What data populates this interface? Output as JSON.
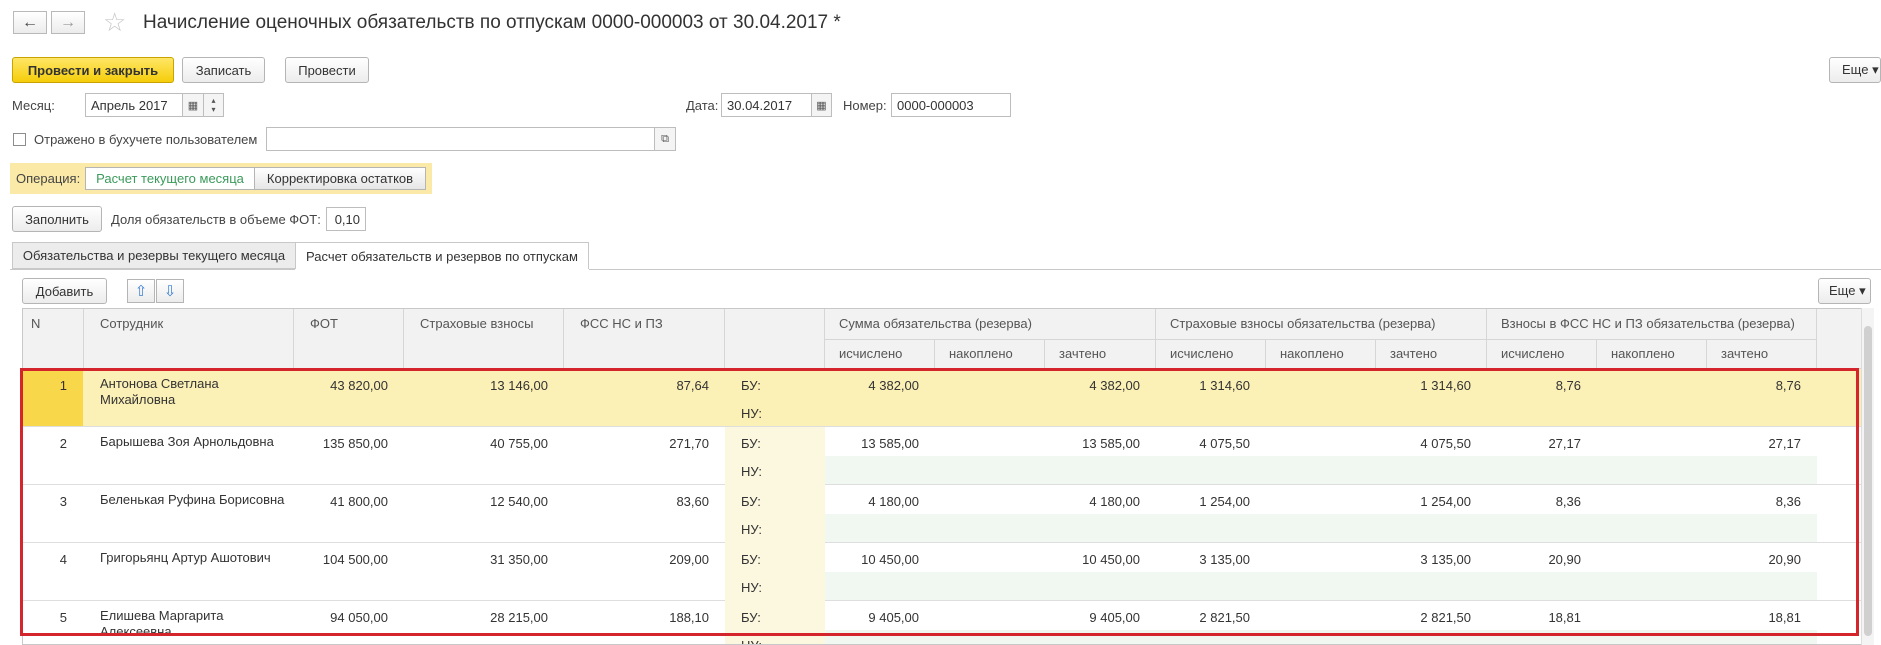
{
  "window": {
    "title": "Начисление оценочных обязательств по отпускам 0000-000003 от 30.04.2017 *",
    "back_icon": "←",
    "forward_icon": "→",
    "star_icon": "☆"
  },
  "toolbar": {
    "post_close": "Провести и закрыть",
    "save": "Записать",
    "post": "Провести",
    "more": "Еще ▾"
  },
  "fields": {
    "month_label": "Месяц:",
    "month_value": "Апрель 2017",
    "date_label": "Дата:",
    "date_value": "30.04.2017",
    "number_label": "Номер:",
    "number_value": "0000-000003",
    "reflected_label": "Отражено в бухучете пользователем",
    "operation_label": "Операция:",
    "operation_options": [
      "Расчет текущего месяца",
      "Корректировка остатков"
    ],
    "fill_button": "Заполнить",
    "share_label": "Доля обязательств в объеме ФОТ:",
    "share_value": "0,10"
  },
  "tabs": [
    "Обязательства и резервы текущего месяца",
    "Расчет обязательств и резервов по отпускам"
  ],
  "table_toolbar": {
    "add": "Добавить",
    "up_icon": "⇧",
    "down_icon": "⇩",
    "more": "Еще ▾"
  },
  "table": {
    "headers": {
      "n": "N",
      "employee": "Сотрудник",
      "fot": "ФОТ",
      "insurance": "Страховые взносы",
      "fss": "ФСС НС и ПЗ",
      "group1": "Сумма обязательства (резерва)",
      "group2": "Страховые взносы обязательства (резерва)",
      "group3": "Взносы в ФСС НС и ПЗ обязательства (резерва)",
      "sub": [
        "исчислено",
        "накоплено",
        "зачтено"
      ]
    },
    "bu_label": "БУ:",
    "nu_label": "НУ:",
    "rows": [
      {
        "n": "1",
        "name": "Антонова Светлана Михайловна",
        "fot": "43 820,00",
        "ins": "13 146,00",
        "fss": "87,64",
        "s1": "4 382,00",
        "s1z": "4 382,00",
        "s2": "1 314,60",
        "s2z": "1 314,60",
        "s3": "8,76",
        "s3z": "8,76"
      },
      {
        "n": "2",
        "name": "Барышева Зоя Арнольдовна",
        "fot": "135 850,00",
        "ins": "40 755,00",
        "fss": "271,70",
        "s1": "13 585,00",
        "s1z": "13 585,00",
        "s2": "4 075,50",
        "s2z": "4 075,50",
        "s3": "27,17",
        "s3z": "27,17"
      },
      {
        "n": "3",
        "name": "Беленькая Руфина Борисовна",
        "fot": "41 800,00",
        "ins": "12 540,00",
        "fss": "83,60",
        "s1": "4 180,00",
        "s1z": "4 180,00",
        "s2": "1 254,00",
        "s2z": "1 254,00",
        "s3": "8,36",
        "s3z": "8,36"
      },
      {
        "n": "4",
        "name": "Григорьянц Артур Ашотович",
        "fot": "104 500,00",
        "ins": "31 350,00",
        "fss": "209,00",
        "s1": "10 450,00",
        "s1z": "10 450,00",
        "s2": "3 135,00",
        "s2z": "3 135,00",
        "s3": "20,90",
        "s3z": "20,90"
      },
      {
        "n": "5",
        "name": "Елишева Маргарита Алексеевна",
        "fot": "94 050,00",
        "ins": "28 215,00",
        "fss": "188,10",
        "s1": "9 405,00",
        "s1z": "9 405,00",
        "s2": "2 821,50",
        "s2z": "2 821,50",
        "s3": "18,81",
        "s3z": "18,81"
      }
    ]
  },
  "colors": {
    "primary_button": "#f5cd0a",
    "selected_row": "#fbf0b6",
    "highlight_frame": "#d4242c",
    "operation_link": "#3a9b5a"
  }
}
